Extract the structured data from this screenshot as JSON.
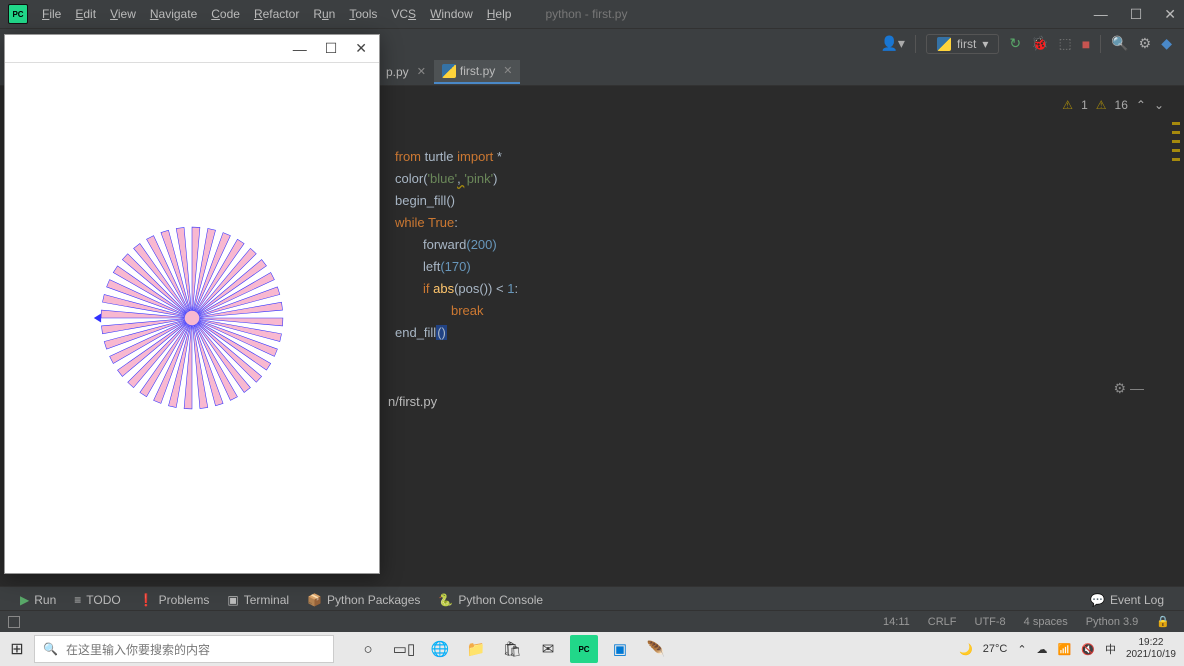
{
  "menu": {
    "items": [
      "File",
      "Edit",
      "View",
      "Navigate",
      "Code",
      "Refactor",
      "Run",
      "Tools",
      "VCS",
      "Window",
      "Help"
    ],
    "context": "python - first.py"
  },
  "toolbar": {
    "run_config": "first"
  },
  "tabs": {
    "t0": "p.py",
    "t1": "first.py"
  },
  "inspections": {
    "err_label": "1",
    "warn_label": "16"
  },
  "code": {
    "l1_from": "from ",
    "l1_mod": "turtle ",
    "l1_imp": "import ",
    "l1_star": "*",
    "l2_fn": "color",
    "l2_p": "(",
    "l2_a": "'blue'",
    "l2_c": ", ",
    "l2_b": "'pink'",
    "l2_q": ")",
    "l3": "begin_fill()",
    "l4_kw": "while ",
    "l4_t": "True",
    "l4_c": ":",
    "l5_fn": "forward",
    "l5_arg": "(200)",
    "l6_fn": "left",
    "l6_arg": "(170)",
    "l7_if": "if ",
    "l7_abs": "abs",
    "l7_p": "(pos()) ",
    "l7_lt": "< ",
    "l7_one": "1",
    "l7_c": ":",
    "l8": "break",
    "l9": "end_fill",
    "l9_p": "()"
  },
  "run_output": "n/first.py",
  "tool_tabs": {
    "run": "Run",
    "todo": "TODO",
    "problems": "Problems",
    "terminal": "Terminal",
    "pkg": "Python Packages",
    "console": "Python Console",
    "event": "Event Log"
  },
  "status": {
    "pos": "14:11",
    "eol": "CRLF",
    "enc": "UTF-8",
    "indent": "4 spaces",
    "py": "Python 3.9"
  },
  "taskbar": {
    "search_placeholder": "在这里输入你要搜索的内容",
    "temp": "27°C",
    "lang": "中",
    "time": "19:22",
    "date": "2021/10/19"
  }
}
